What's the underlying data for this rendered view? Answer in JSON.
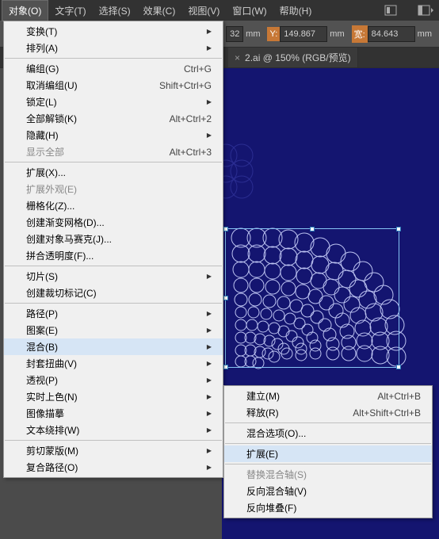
{
  "menubar": {
    "items": [
      "对象(O)",
      "文字(T)",
      "选择(S)",
      "效果(C)",
      "视图(V)",
      "窗口(W)",
      "帮助(H)"
    ]
  },
  "propbar": {
    "x_val": "32",
    "x_unit": "mm",
    "y_label": "Y:",
    "y_val": "149.867",
    "y_unit": "mm",
    "w_label": "宽:",
    "w_val": "84.643",
    "w_unit": "mm"
  },
  "tab": {
    "close": "×",
    "title": "2.ai @ 150% (RGB/预览)"
  },
  "mainMenu": {
    "sect1": [
      {
        "label": "变换(T)",
        "arrow": true
      },
      {
        "label": "排列(A)",
        "arrow": true
      }
    ],
    "sect2": [
      {
        "label": "编组(G)",
        "shortcut": "Ctrl+G"
      },
      {
        "label": "取消编组(U)",
        "shortcut": "Shift+Ctrl+G"
      },
      {
        "label": "锁定(L)",
        "arrow": true
      },
      {
        "label": "全部解锁(K)",
        "shortcut": "Alt+Ctrl+2"
      },
      {
        "label": "隐藏(H)",
        "arrow": true
      },
      {
        "label": "显示全部",
        "shortcut": "Alt+Ctrl+3",
        "disabled": true
      }
    ],
    "sect3": [
      {
        "label": "扩展(X)..."
      },
      {
        "label": "扩展外观(E)",
        "disabled": true
      },
      {
        "label": "栅格化(Z)..."
      },
      {
        "label": "创建渐变网格(D)..."
      },
      {
        "label": "创建对象马赛克(J)..."
      },
      {
        "label": "拼合透明度(F)..."
      }
    ],
    "sect4": [
      {
        "label": "切片(S)",
        "arrow": true
      },
      {
        "label": "创建裁切标记(C)"
      }
    ],
    "sect5": [
      {
        "label": "路径(P)",
        "arrow": true
      },
      {
        "label": "图案(E)",
        "arrow": true
      },
      {
        "label": "混合(B)",
        "arrow": true,
        "highlighted": true
      },
      {
        "label": "封套扭曲(V)",
        "arrow": true
      },
      {
        "label": "透视(P)",
        "arrow": true
      },
      {
        "label": "实时上色(N)",
        "arrow": true
      },
      {
        "label": "图像描摹",
        "arrow": true
      },
      {
        "label": "文本绕排(W)",
        "arrow": true
      }
    ],
    "sect6": [
      {
        "label": "剪切蒙版(M)",
        "arrow": true
      },
      {
        "label": "复合路径(O)",
        "arrow": true
      }
    ]
  },
  "subMenu": {
    "sect1": [
      {
        "label": "建立(M)",
        "shortcut": "Alt+Ctrl+B"
      },
      {
        "label": "释放(R)",
        "shortcut": "Alt+Shift+Ctrl+B"
      }
    ],
    "sect2": [
      {
        "label": "混合选项(O)..."
      }
    ],
    "sect3": [
      {
        "label": "扩展(E)",
        "highlighted": true
      }
    ],
    "sect4": [
      {
        "label": "替换混合轴(S)",
        "disabled": true
      },
      {
        "label": "反向混合轴(V)"
      },
      {
        "label": "反向堆叠(F)"
      }
    ]
  }
}
